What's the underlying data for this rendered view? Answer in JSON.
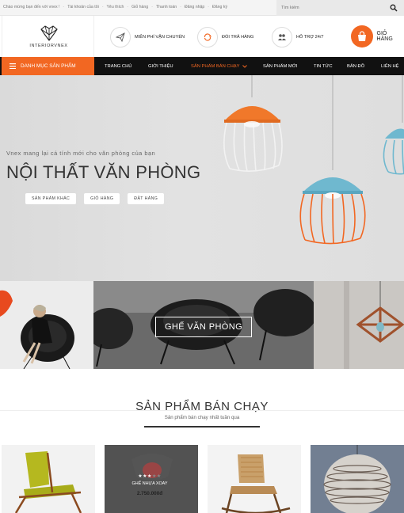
{
  "topbar": {
    "welcome": "Chào mừng bạn đến với  vnex !",
    "links": [
      "Tài khoản của tôi",
      "Yêu thích",
      "Giỏ hàng",
      "Thanh toán",
      "Đăng nhập",
      "Đăng ký"
    ],
    "search_placeholder": "Tìm kiếm"
  },
  "header": {
    "logo_text": "INTERIORVNEX",
    "features": [
      {
        "label": "MIỄN PHÍ VẬN CHUYỂN",
        "icon": "paper-plane-icon"
      },
      {
        "label": "ĐỔI TRẢ HÀNG",
        "icon": "refresh-icon"
      },
      {
        "label": "HỖ TRỢ 24/7",
        "icon": "users-icon"
      }
    ],
    "cart_label": "GIỎ HÀNG"
  },
  "nav": {
    "category_button": "DANH MỤC SẢN PHẨM",
    "items": [
      "TRANG CHỦ",
      "GIỚI THIỆU",
      "SẢN PHẨM BÁN CHẠY",
      "SẢN PHẨM MỚI",
      "TIN TỨC",
      "BẢN ĐỒ",
      "LIÊN HỆ"
    ],
    "active_index": 2
  },
  "hero": {
    "tagline": "Vnex mang lại cá tính mới cho văn phòng của bạn",
    "title": "NỘI THẤT VĂN PHÒNG",
    "buttons": [
      "SẢN PHẨM KHÁC",
      "GIỎ HÀNG",
      "ĐẶT HÀNG"
    ]
  },
  "banner": {
    "center_label": "GHẾ VĂN PHÒNG"
  },
  "section": {
    "title": "SẢN PHẨM BÁN CHẠY",
    "subtitle": "Sản phẩm bán chạy nhất tuần qua"
  },
  "products": [
    {
      "name": "",
      "price": ""
    },
    {
      "name": "GHẾ NHỰA XOAY",
      "price": "2.750.000đ",
      "rating": 3,
      "rating_max": 5
    },
    {
      "name": "",
      "price": ""
    },
    {
      "name": "",
      "price": ""
    }
  ],
  "colors": {
    "accent": "#f26722",
    "nav_bg": "#111111",
    "lamp_blue": "#6fb8cf"
  }
}
